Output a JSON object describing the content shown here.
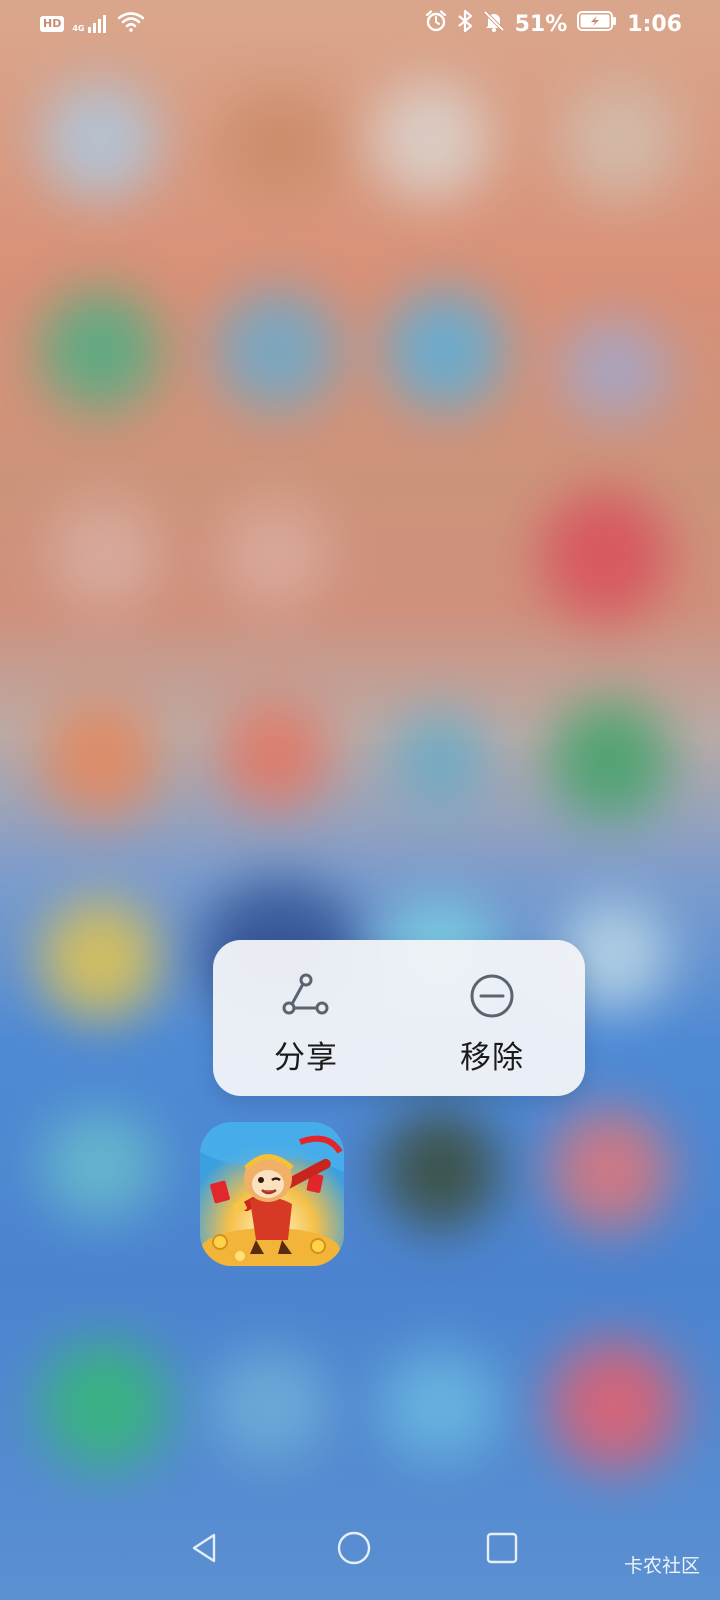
{
  "status_bar": {
    "hd_badge": "HD",
    "network_type": "4G",
    "battery_percent": "51%",
    "time": "1:06",
    "icons": [
      "signal-icon",
      "wifi-icon",
      "alarm-icon",
      "bluetooth-icon",
      "mute-icon",
      "battery-charging-icon"
    ]
  },
  "context_menu": {
    "actions": [
      {
        "label": "分享",
        "icon": "share-icon"
      },
      {
        "label": "移除",
        "icon": "remove-icon"
      }
    ]
  },
  "app_icon": {
    "icon": "monkey-king-app-icon"
  },
  "nav_bar": {
    "buttons": [
      "back-icon",
      "home-icon",
      "recents-icon"
    ]
  },
  "watermark": "卡农社区",
  "colors": {
    "menu_bg": "#f0f2f7",
    "menu_icon": "#5c6370",
    "menu_text": "#1b1b1b"
  }
}
